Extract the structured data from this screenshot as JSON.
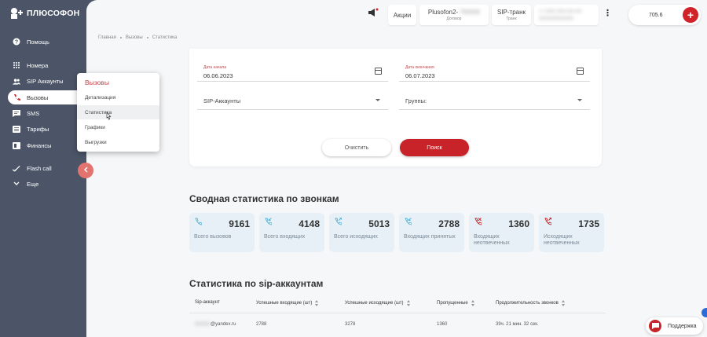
{
  "brand": {
    "name": "ПЛЮСОФОН",
    "accent": "#d1232a"
  },
  "sidebar": {
    "items": [
      {
        "label": "Помощь",
        "icon": "help-icon"
      },
      {
        "label": "Номера",
        "icon": "dialpad-icon"
      },
      {
        "label": "SIP Аккаунты",
        "icon": "users-icon"
      },
      {
        "label": "Вызовы",
        "icon": "phone-icon",
        "active": true
      },
      {
        "label": "SMS",
        "icon": "message-icon"
      },
      {
        "label": "Тарифы",
        "icon": "list-icon"
      },
      {
        "label": "Финансы",
        "icon": "wallet-icon"
      },
      {
        "label": "Flash call",
        "icon": "flash-call-icon"
      },
      {
        "label": "Еще",
        "icon": "chevron-down-icon"
      }
    ]
  },
  "topbar": {
    "promo_label": "Акции",
    "contract_title": "Plusofon2-",
    "contract_blurred": "7XXXX",
    "contract_sub": "Договор",
    "trunk_title": "SIP-транк",
    "trunk_sub": "Транк",
    "blurred_line1": "+7 XXX XXX-XX-XX",
    "blurred_line2": "XXXXXXXXXXX",
    "balance": "705.6"
  },
  "breadcrumb": [
    "Главная",
    "Вызовы",
    "Статистика"
  ],
  "filters": {
    "date_start_label": "Дата начала",
    "date_start_value": "06.06.2023",
    "date_end_label": "Дата окончания",
    "date_end_value": "06.07.2023",
    "sip_placeholder": "SIP-Аккаунты",
    "groups_placeholder": "Группы:",
    "clear_label": "Очистить",
    "search_label": "Поиск"
  },
  "dropdown": {
    "title": "Вызовы",
    "items": [
      "Детализация",
      "Статистика",
      "Графики",
      "Выгрузки"
    ]
  },
  "summary": {
    "title": "Сводная статистика по звонкам",
    "cards": [
      {
        "value": "9161",
        "caption": "Всего вызовов",
        "icon": "phone-icon"
      },
      {
        "value": "4148",
        "caption": "Всего входящих",
        "icon": "incoming-call-icon"
      },
      {
        "value": "5013",
        "caption": "Всего исходящих",
        "icon": "outgoing-call-icon"
      },
      {
        "value": "2788",
        "caption": "Входящих принятых",
        "icon": "incoming-call-icon"
      },
      {
        "value": "1360",
        "caption": "Входящих неотвеченных",
        "icon": "missed-call-icon"
      },
      {
        "value": "1735",
        "caption": "Исходящих неотвеченных",
        "icon": "outgoing-missed-call-icon"
      }
    ]
  },
  "sip_table": {
    "title": "Статистика по sip-аккаунтам",
    "columns": [
      "Sip-аккаунт",
      "Успешные входящие (шт)",
      "Успешные исходящие (шт)",
      "Пропущенные",
      "Продолжительность звонков"
    ],
    "rows": [
      {
        "account_blurred": "XXXXX",
        "account_domain": "@yandex.ru",
        "incoming": "2788",
        "outgoing": "3278",
        "missed": "1360",
        "duration": "39ч. 21 мин. 32 сек."
      }
    ]
  },
  "support_label": "Поддержка"
}
